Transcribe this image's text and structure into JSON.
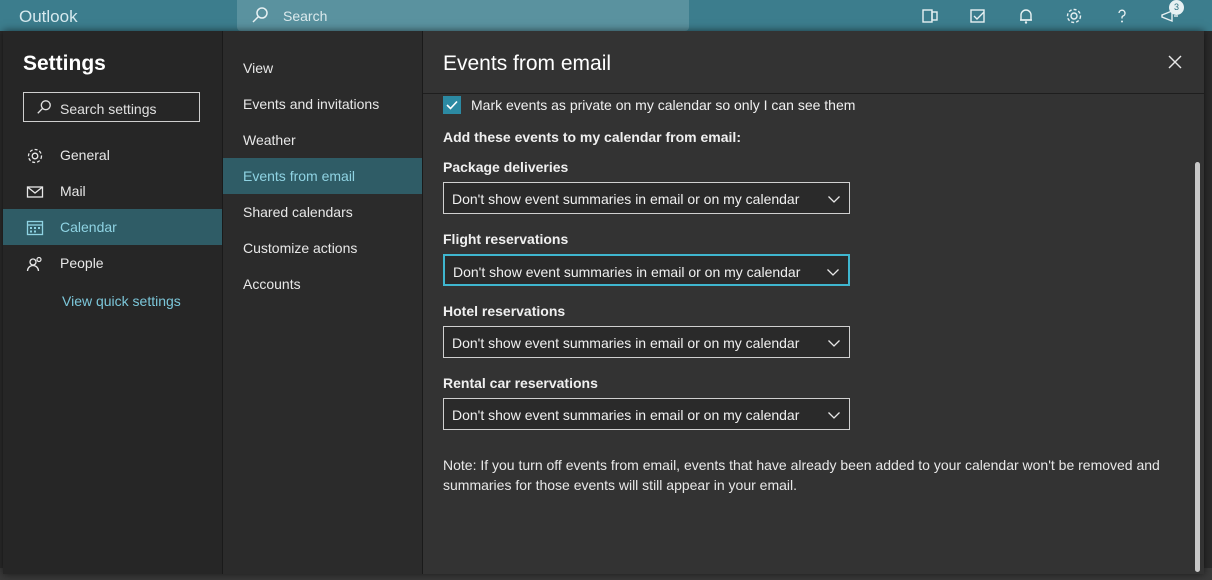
{
  "app": {
    "title": "Outlook"
  },
  "topbar": {
    "search_placeholder": "Search",
    "notification_count": "3"
  },
  "settings": {
    "title": "Settings",
    "search_placeholder": "Search settings",
    "categories": [
      {
        "label": "General",
        "icon": "gear-icon"
      },
      {
        "label": "Mail",
        "icon": "mail-icon"
      },
      {
        "label": "Calendar",
        "icon": "calendar-icon"
      },
      {
        "label": "People",
        "icon": "people-icon"
      }
    ],
    "quick_link": "View quick settings"
  },
  "subnav": {
    "items": [
      "View",
      "Events and invitations",
      "Weather",
      "Events from email",
      "Shared calendars",
      "Customize actions",
      "Accounts"
    ]
  },
  "main": {
    "title": "Events from email",
    "private_checkbox": {
      "label": "Mark events as private on my calendar so only I can see them",
      "checked": true
    },
    "section_label": "Add these events to my calendar from email:",
    "fields": [
      {
        "label": "Package deliveries",
        "value": "Don't show event summaries in email or on my calendar"
      },
      {
        "label": "Flight reservations",
        "value": "Don't show event summaries in email or on my calendar"
      },
      {
        "label": "Hotel reservations",
        "value": "Don't show event summaries in email or on my calendar"
      },
      {
        "label": "Rental car reservations",
        "value": "Don't show event summaries in email or on my calendar"
      }
    ],
    "note": "Note: If you turn off events from email, events that have already been added to your calendar won't be removed and summaries for those events will still appear in your email."
  },
  "colors": {
    "accent": "#3fb6cf",
    "topbar": "#3c7d8d",
    "active_bg": "#2f5c66"
  }
}
